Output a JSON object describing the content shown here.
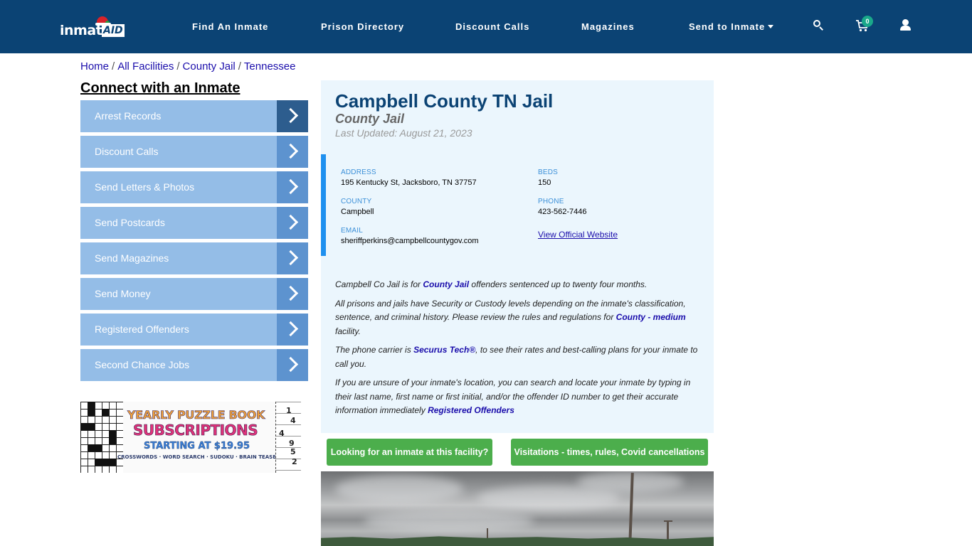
{
  "header": {
    "logo_text": "inmate",
    "logo_badge": "AID",
    "nav": [
      {
        "label": "Find An Inmate"
      },
      {
        "label": "Prison Directory"
      },
      {
        "label": "Discount Calls"
      },
      {
        "label": "Magazines"
      },
      {
        "label": "Send to Inmate",
        "has_dropdown": true
      }
    ],
    "icons": [
      "search-icon",
      "cart-icon",
      "user-icon"
    ],
    "cart_count": "0"
  },
  "breadcrumb": [
    {
      "label": "Home"
    },
    {
      "label": "All Facilities"
    },
    {
      "label": "County Jail"
    },
    {
      "label": "Tennessee"
    }
  ],
  "breadcrumb_separator": "/",
  "sidebar": {
    "title": "Connect with an Inmate",
    "items": [
      {
        "label": "Arrest Records",
        "active": true
      },
      {
        "label": "Discount Calls"
      },
      {
        "label": "Send Letters & Photos"
      },
      {
        "label": "Send Postcards"
      },
      {
        "label": "Send Magazines"
      },
      {
        "label": "Send Money"
      },
      {
        "label": "Registered Offenders"
      },
      {
        "label": "Second Chance Jobs"
      }
    ],
    "ad": {
      "line1": "YEARLY PUZZLE BOOK",
      "line2": "SUBSCRIPTIONS",
      "line3": "STARTING AT $19.95",
      "line4": "CROSSWORDS · WORD SEARCH · SUDOKU · BRAIN TEASERS",
      "sudoku_digits": [
        "1",
        "4",
        "4",
        "9",
        "5",
        "2"
      ]
    }
  },
  "facility": {
    "name": "Campbell County TN Jail",
    "type": "County Jail",
    "last_updated": "Last Updated: August 21, 2023",
    "fields": {
      "address_label": "ADDRESS",
      "address": "195 Kentucky St, Jacksboro, TN 37757",
      "beds_label": "BEDS",
      "beds": "150",
      "county_label": "COUNTY",
      "county": "Campbell",
      "phone_label": "PHONE",
      "phone": "423-562-7446",
      "email_label": "EMAIL",
      "email": "sheriffperkins@campbellcountygov.com",
      "website_link": "View Official Website"
    },
    "description": {
      "p1_pre": "Campbell Co Jail is for ",
      "p1_link": "County Jail",
      "p1_post": " offenders sentenced up to twenty four months.",
      "p2_pre": "All prisons and jails have Security or Custody levels depending on the inmate's classification, sentence, and criminal history. Please review the rules and regulations for ",
      "p2_link": "County - medium",
      "p2_post": " facility.",
      "p3_pre": "The phone carrier is ",
      "p3_link": "Securus Tech®",
      "p3_post": ", to see their rates and best-calling plans for your inmate to call you.",
      "p4_pre": "If you are unsure of your inmate's location, you can search and locate your inmate by typing in their last name, first name or first initial, and/or the offender ID number to get their accurate information immediately ",
      "p4_link": "Registered Offenders"
    },
    "buttons": {
      "find_inmate": "Looking for an inmate at this facility?",
      "visitations": "Visitations - times, rules, Covid cancellations"
    }
  },
  "colors": {
    "header_bg": "#0b4374",
    "sidebar_item": "#94bde7",
    "sidebar_arrow": "#5d93cf",
    "sidebar_arrow_active": "#2d5d8e",
    "panel_bg": "#ebf6fd",
    "accent_bar": "#1e90ef",
    "green_button": "#4cae4c",
    "cart_badge": "#1aa88a"
  }
}
